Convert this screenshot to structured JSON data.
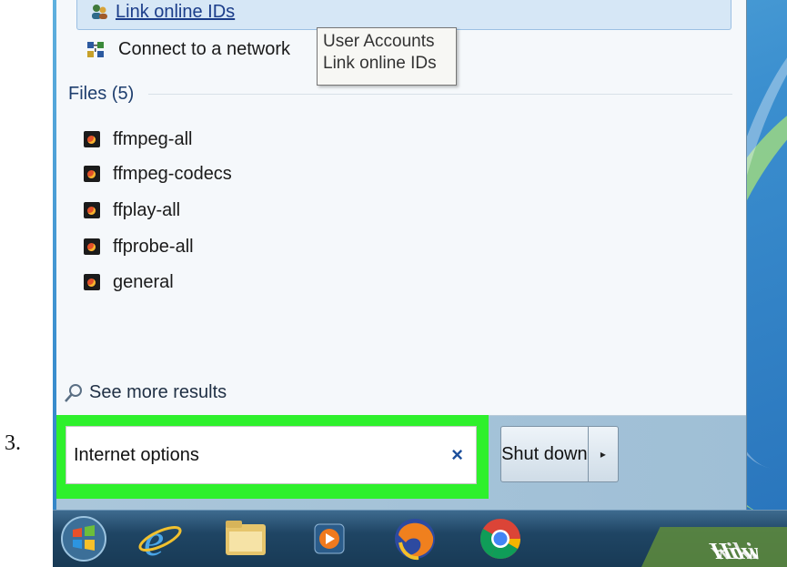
{
  "step_number": "3.",
  "results": {
    "link_online_ids": "Link online IDs",
    "connect_network": "Connect to a network",
    "tooltip_line1": "User Accounts",
    "tooltip_line2": "Link online IDs",
    "files_header": "Files (5)",
    "files": [
      {
        "name": "ffmpeg-all"
      },
      {
        "name": "ffmpeg-codecs"
      },
      {
        "name": "ffplay-all"
      },
      {
        "name": "ffprobe-all"
      },
      {
        "name": "general"
      }
    ],
    "see_more": "See more results"
  },
  "search": {
    "value": "Internet options",
    "clear_symbol": "×"
  },
  "shutdown": {
    "label": "Shut down",
    "arrow": "▸"
  },
  "taskbar": {
    "icons": [
      "start-orb-icon",
      "internet-explorer-icon",
      "file-explorer-icon",
      "media-player-icon",
      "firefox-icon",
      "chrome-icon"
    ]
  },
  "watermark": {
    "wiki": "wiki",
    "how": "How"
  },
  "colors": {
    "highlight": "#2ef02c",
    "link": "#1b3d8a"
  }
}
